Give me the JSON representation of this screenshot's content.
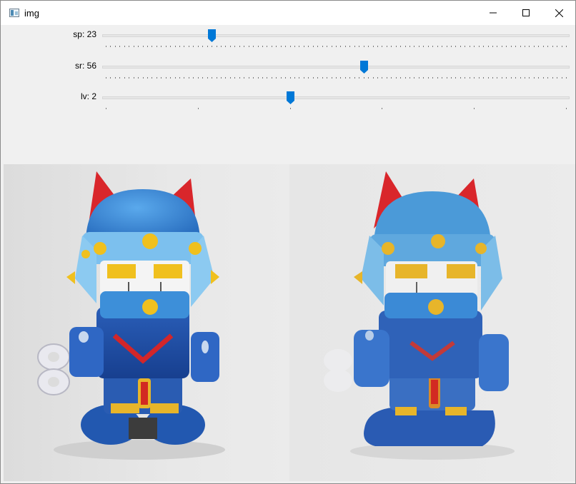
{
  "window": {
    "title": "img",
    "icon": "window-app-icon",
    "buttons": [
      "minimize-icon",
      "maximize-icon",
      "close-icon"
    ]
  },
  "trackbars": [
    {
      "label": "sp: 23",
      "value": 23,
      "max": 100
    },
    {
      "label": "sr: 56",
      "value": 56,
      "max": 100
    },
    {
      "label": "lv: 2",
      "value": 2,
      "max": 5
    }
  ],
  "colors": {
    "thumb": "#0078d7",
    "helmet": "#3d8fd9",
    "horns": "#d9262b",
    "studs": "#f0c01e",
    "body": "#1f4fa8",
    "filtered_body": "#2a5bb3"
  }
}
